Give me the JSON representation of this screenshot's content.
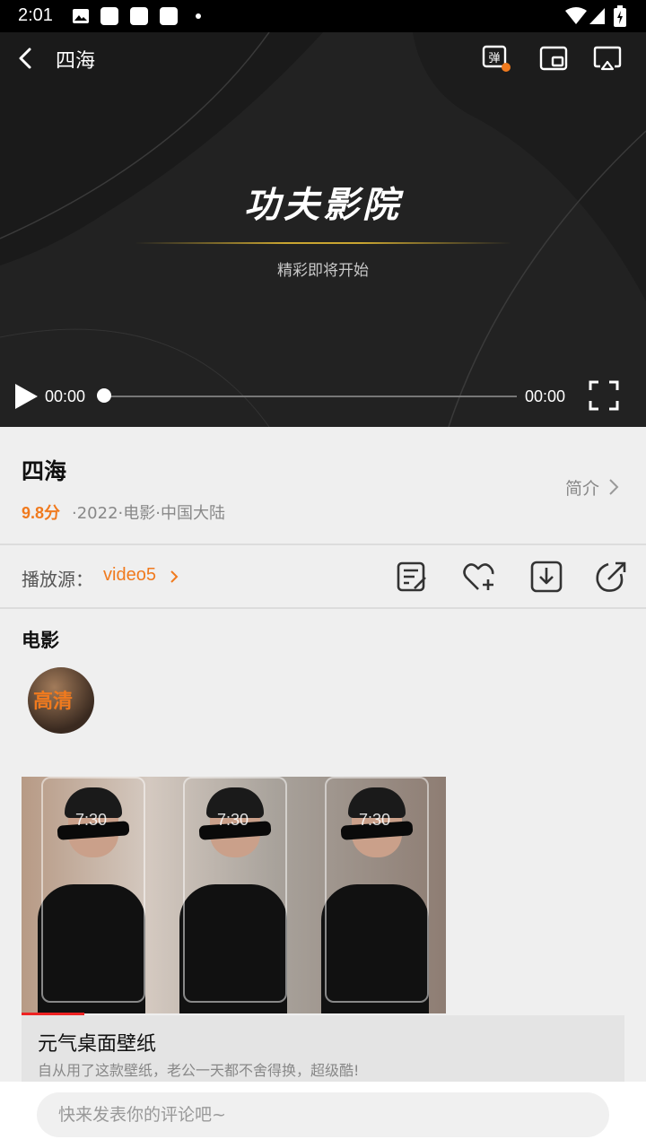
{
  "status_bar": {
    "time": "2:01"
  },
  "player": {
    "title": "四海",
    "logo_text": "功夫影院",
    "subtitle": "精彩即将开始",
    "current_time": "00:00",
    "duration": "00:00",
    "progress": 0,
    "danmaku_label": "弹"
  },
  "info": {
    "title": "四海",
    "score": "9.8分",
    "meta": "·2022·电影·中国大陆",
    "intro_label": "简介"
  },
  "source": {
    "label": "播放源：",
    "value": "video5"
  },
  "section": {
    "title": "电影",
    "avatar_text": "高清"
  },
  "ad": {
    "phone_time": "7:30",
    "title": "元气桌面壁纸",
    "description": "自从用了这款壁纸，老公一天都不舍得换，超级酷!"
  },
  "comment": {
    "placeholder": "快来发表你的评论吧~"
  },
  "colors": {
    "accent": "#f07a1e",
    "player_bg": "#202020",
    "page_bg": "#efefef"
  }
}
